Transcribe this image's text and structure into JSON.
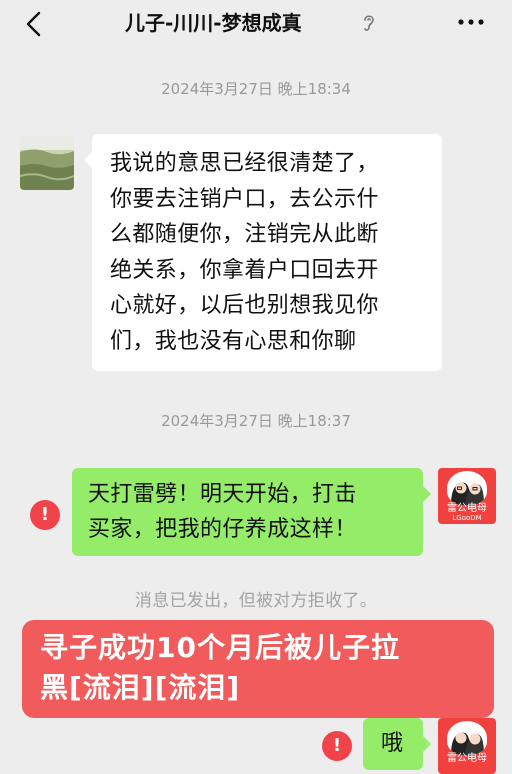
{
  "header": {
    "title": "儿子-川川-梦想成真",
    "back_icon": "chevron-left-icon",
    "ear_icon": "earpiece-mode-icon",
    "more_icon": "more-dots-icon"
  },
  "messages": {
    "timestamp_1": "2024年3月27日 晚上18:34",
    "incoming_1_lines": [
      "我说的意思已经很清楚了，",
      "你要去注销户口，去公示什",
      "么都随便你，注销完从此断",
      "绝关系，你拿着户口回去开",
      "心就好，以后也别想我见你",
      "们，我也没有心思和你聊"
    ],
    "timestamp_2": "2024年3月27日 晚上18:37",
    "outgoing_1_lines": [
      "天打雷劈！明天开始，打击",
      "买家，把我的仔养成这样！"
    ],
    "error_mark": "!",
    "system_note": "消息已发出，但被对方拒收了。",
    "outgoing_2": "哦"
  },
  "overlay": {
    "caption_lines": [
      "寻子成功10个月后被儿子拉",
      "黑[流泪][流泪]"
    ]
  },
  "self_avatar": {
    "brand_cn": "雷公电母",
    "brand_en": "LGooDM"
  },
  "colors": {
    "background": "#ededed",
    "incoming_bubble": "#ffffff",
    "outgoing_bubble": "#95ec69",
    "error_red": "#f2434b",
    "avatar_red": "#f0413f",
    "caption_red": "#f25b5b"
  }
}
